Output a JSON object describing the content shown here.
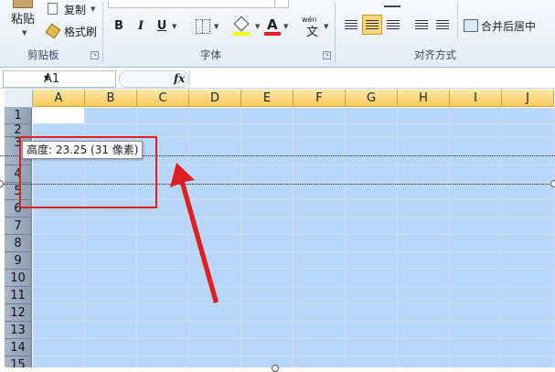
{
  "ribbon": {
    "paste_label": "粘贴",
    "copy_label": "复制",
    "format_painter_label": "格式刷",
    "clipboard_group": "剪贴板",
    "font_group": "字体",
    "bold": "B",
    "italic": "I",
    "underline": "U",
    "phonetic": "wén",
    "alignment_group": "对齐方式",
    "merge_center_label": "合并后居中"
  },
  "formula_bar": {
    "name_box": "A1",
    "fx": "fx"
  },
  "sheet": {
    "columns": [
      "A",
      "B",
      "C",
      "D",
      "E",
      "F",
      "G",
      "H",
      "I",
      "J"
    ],
    "rows": [
      "1",
      "2",
      "3",
      "4",
      "5",
      "6",
      "7",
      "8",
      "9",
      "10",
      "11",
      "12",
      "13",
      "14",
      "15"
    ]
  },
  "tooltip": "高度: 23.25 (31 像素)",
  "colors": {
    "selection": "#b8d6f8",
    "annotation": "#e02020",
    "column_header": "#f7c95a"
  }
}
